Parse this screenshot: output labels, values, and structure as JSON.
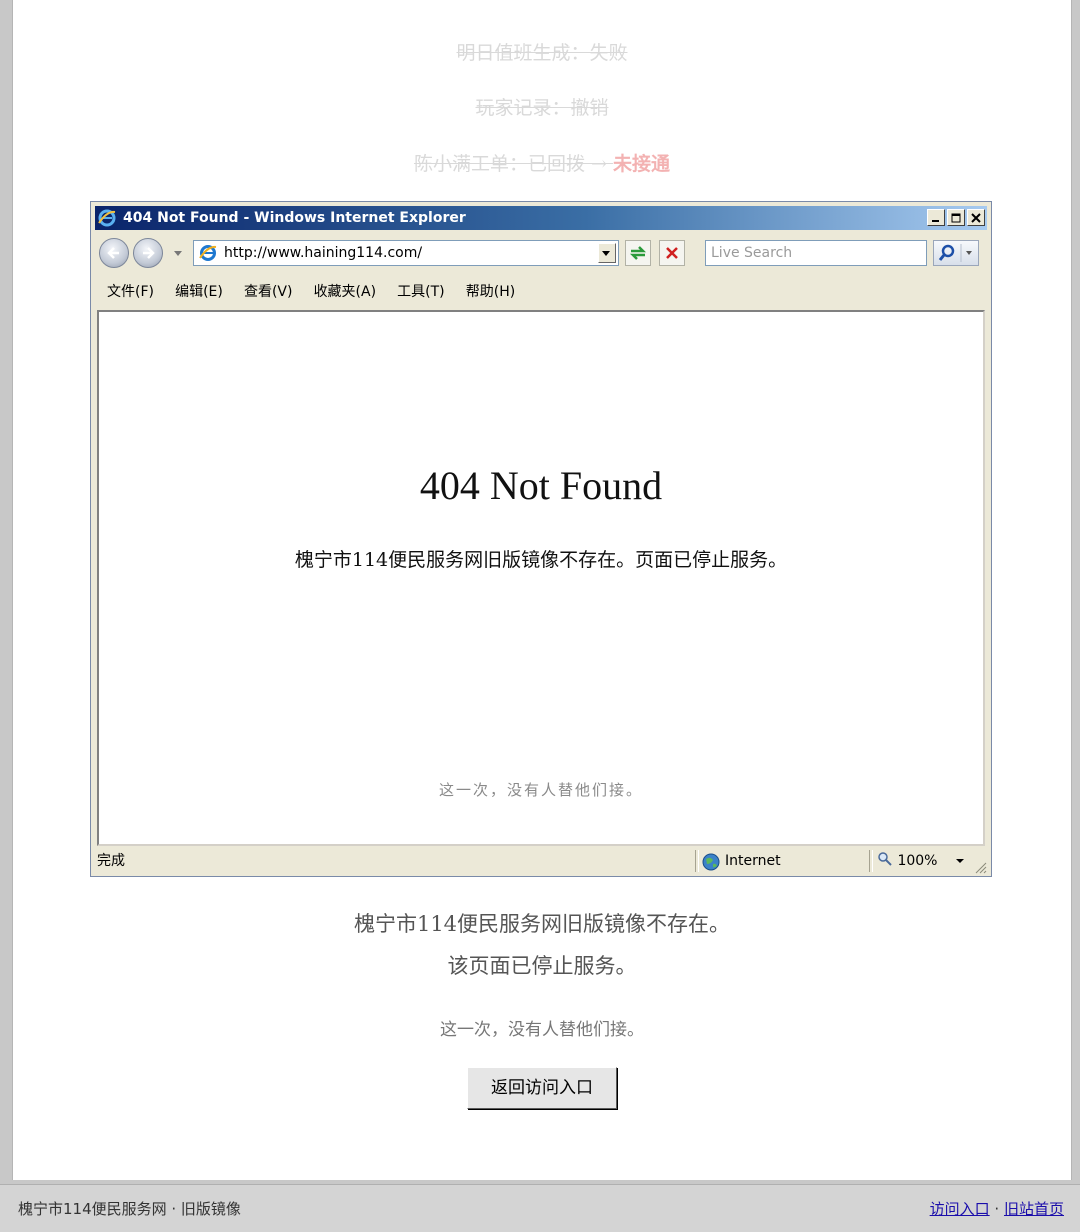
{
  "background_lines": [
    {
      "text": "明日值班生成：失败"
    },
    {
      "text": "玩家记录：撤销"
    },
    {
      "text": "陈小满工单：已回拨 → ",
      "accent": "未接通"
    }
  ],
  "browser": {
    "title": "404 Not Found - Windows Internet Explorer",
    "address": "http://www.haining114.com/",
    "search_placeholder": "Live Search",
    "menu": [
      "文件(F)",
      "编辑(E)",
      "查看(V)",
      "收藏夹(A)",
      "工具(T)",
      "帮助(H)"
    ],
    "content": {
      "heading": "404 Not Found",
      "description": "槐宁市114便民服务网旧版镜像不存在。页面已停止服务。",
      "footnote": "这一次，没有人替他们接。"
    },
    "status": {
      "text": "完成",
      "zone": "Internet",
      "zoom": "100%"
    }
  },
  "below": {
    "line1": "槐宁市114便民服务网旧版镜像不存在。",
    "line2": "该页面已停止服务。",
    "line3": "这一次，没有人替他们接。",
    "button": "返回访问入口"
  },
  "footer": {
    "site": "槐宁市114便民服务网 · 旧版镜像",
    "link1": "访问入口",
    "separator": "·",
    "link2": "旧站首页"
  },
  "colors": {
    "accent": "#f3b2b2",
    "titlebar": "#0a246a"
  }
}
